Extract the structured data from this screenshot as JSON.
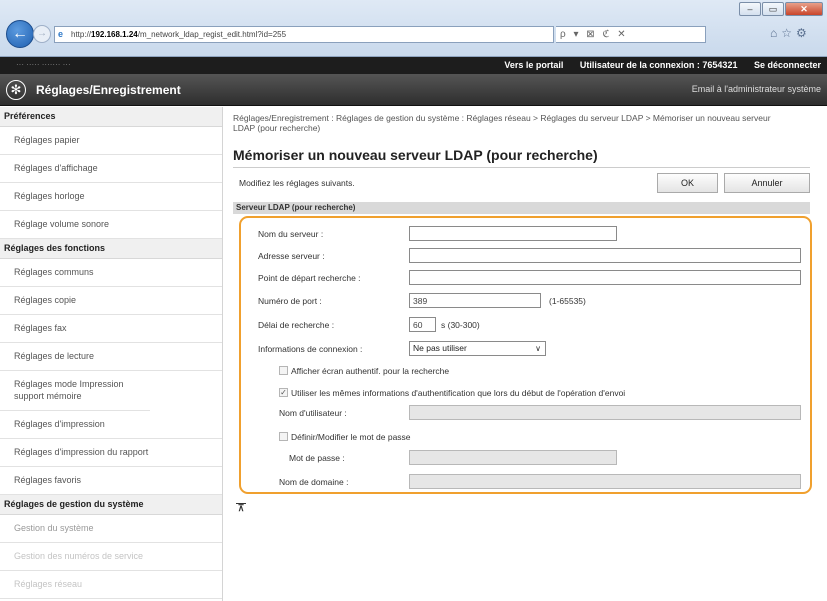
{
  "browser": {
    "url_prefix": "http://",
    "url_host": "192.168.1.24",
    "url_path": "/m_network_ldap_regist_edit.html?id=255",
    "addr_tools": [
      "ρ",
      "▾",
      "⊠",
      "ℭ",
      "✕"
    ],
    "icons": [
      "home-icon",
      "star-icon",
      "gear-icon"
    ]
  },
  "topbar": {
    "device_name": "···  ····· ······· ···",
    "portal_link": "Vers le portail",
    "user_label": "Utilisateur de la connexion :  7654321",
    "logout_link": "Se déconnecter"
  },
  "header": {
    "title": "Réglages/Enregistrement",
    "email_link": "Email à l'administrateur système"
  },
  "sidebar": {
    "sections": [
      {
        "heading": "Préférences",
        "items": [
          "Réglages papier",
          "Réglages d'affichage",
          "Réglages horloge",
          "Réglage volume sonore"
        ]
      },
      {
        "heading": "Réglages des fonctions",
        "items": [
          "Réglages communs",
          "Réglages copie",
          "Réglages fax",
          "Réglages de lecture",
          "Réglages mode Impression support mémoire",
          "Réglages d'impression",
          "Réglages d'impression du rapport",
          "Réglages favoris"
        ]
      },
      {
        "heading": "Réglages de gestion du système",
        "items": [
          "Gestion du système",
          "Gestion des numéros de service",
          "Réglages réseau"
        ]
      }
    ]
  },
  "main": {
    "breadcrumb": "Réglages/Enregistrement : Réglages de gestion du système : Réglages réseau > Réglages du serveur LDAP > Mémoriser un nouveau serveur LDAP (pour recherche)",
    "page_title": "Mémoriser un nouveau serveur LDAP (pour recherche)",
    "intro": "Modifiez les réglages suivants.",
    "ok_label": "OK",
    "cancel_label": "Annuler",
    "section_title": "Serveur LDAP (pour recherche)",
    "form": {
      "server_name_label": "Nom du serveur :",
      "server_name_value": "",
      "server_address_label": "Adresse serveur :",
      "server_address_value": "",
      "search_root_label": "Point de départ recherche :",
      "search_root_value": "",
      "port_label": "Numéro de port :",
      "port_value": "389",
      "port_hint": "(1-65535)",
      "timeout_label": "Délai de recherche :",
      "timeout_value": "60",
      "timeout_hint": "s (30-300)",
      "login_info_label": "Informations de connexion :",
      "login_info_value": "Ne pas utiliser",
      "show_auth_label": "Afficher écran authentif. pour la recherche",
      "show_auth_checked": false,
      "same_auth_label": "Utiliser les mêmes informations d'authentification que lors du début de l'opération d'envoi",
      "same_auth_checked": true,
      "username_label": "Nom d'utilisateur :",
      "set_password_label": "Définir/Modifier le mot de passe",
      "set_password_checked": false,
      "password_label": "Mot de passe :",
      "domain_label": "Nom de domaine :"
    },
    "top_link": "⊼"
  }
}
